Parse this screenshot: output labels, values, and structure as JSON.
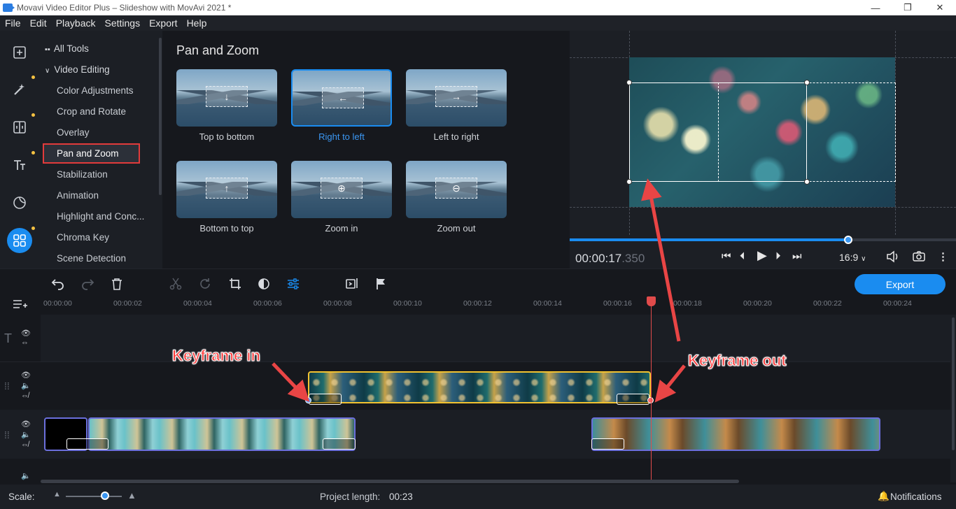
{
  "window": {
    "title": "Movavi Video Editor Plus – Slideshow with MovAvi 2021 *",
    "controls": [
      "—",
      "❐",
      "✕"
    ]
  },
  "menu": [
    "File",
    "Edit",
    "Playback",
    "Settings",
    "Export",
    "Help"
  ],
  "sidebar_tools": {
    "icons": [
      "import-icon",
      "magic-wand-icon",
      "transitions-icon",
      "titles-icon",
      "stickers-icon",
      "more-tools-icon"
    ]
  },
  "tool_panel": {
    "all_tools": "All Tools",
    "section": "Video Editing",
    "items": [
      "Color Adjustments",
      "Crop and Rotate",
      "Overlay",
      "Pan and Zoom",
      "Stabilization",
      "Animation",
      "Highlight and Conc...",
      "Chroma Key",
      "Scene Detection"
    ],
    "selected_index": 3
  },
  "effects": {
    "title": "Pan and Zoom",
    "items": [
      {
        "label": "Top to bottom",
        "glyph": "↓"
      },
      {
        "label": "Right to left",
        "glyph": "←"
      },
      {
        "label": "Left to right",
        "glyph": "→"
      },
      {
        "label": "Bottom to top",
        "glyph": "↑"
      },
      {
        "label": "Zoom in",
        "glyph": "⊕"
      },
      {
        "label": "Zoom out",
        "glyph": "⊖"
      }
    ],
    "selected_index": 1
  },
  "player": {
    "timecode_main": "00:00:17",
    "timecode_ms": ".350",
    "aspect": "16:9",
    "progress": 0.72
  },
  "toolbar": {
    "export_label": "Export"
  },
  "ruler": {
    "labels": [
      "00:00:00",
      "00:00:02",
      "00:00:04",
      "00:00:06",
      "00:00:08",
      "00:00:10",
      "00:00:12",
      "00:00:14",
      "00:00:16",
      "00:00:18",
      "00:00:20",
      "00:00:22",
      "00:00:24"
    ]
  },
  "annotations": {
    "keyframe_in": "Keyframe in",
    "keyframe_out": "Keyframe out"
  },
  "status": {
    "scale_label": "Scale:",
    "project_length_label": "Project length:",
    "project_length_value": "00:23",
    "notifications": "Notifications"
  },
  "colors": {
    "accent": "#1a8cf0",
    "annotation": "#ff3b3b",
    "playhead": "#e14b4b",
    "clip_border_selected": "#f2c230"
  }
}
